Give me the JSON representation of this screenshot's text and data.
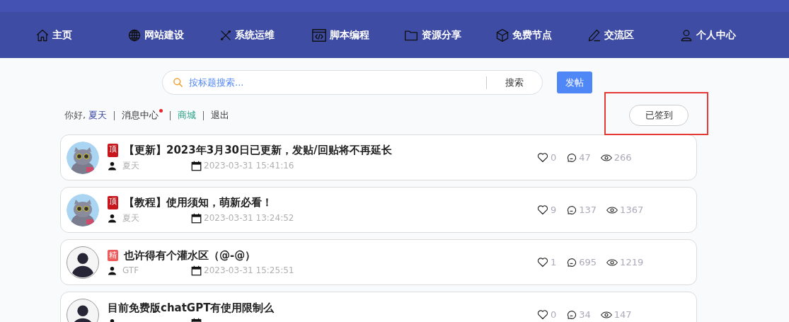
{
  "nav": [
    {
      "label": "主页"
    },
    {
      "label": "网站建设"
    },
    {
      "label": "系统运维"
    },
    {
      "label": "脚本编程"
    },
    {
      "label": "资源分享"
    },
    {
      "label": "免费节点"
    },
    {
      "label": "交流区"
    },
    {
      "label": "个人中心"
    }
  ],
  "search": {
    "placeholder": "按标题搜索...",
    "button": "搜索"
  },
  "post_button": "发帖",
  "user_bar": {
    "greeting": "你好,",
    "username": "夏天",
    "links": [
      {
        "label": "消息中心",
        "unread": true
      },
      {
        "label": "商城",
        "unread": false
      },
      {
        "label": "退出",
        "unread": false
      }
    ]
  },
  "checkin": {
    "label": "已签到",
    "highlighted": true
  },
  "posts": [
    {
      "kind": "picture",
      "badge": {
        "kind": "top",
        "label": "顶"
      },
      "title": "【更新】2023年3月30日已更新，发贴/回贴将不再延长",
      "author": "夏天",
      "date": "2023-03-31 15:41:16",
      "likes": "0",
      "comments": "47",
      "views": "266"
    },
    {
      "kind": "picture",
      "badge": {
        "kind": "top",
        "label": "顶"
      },
      "title": "【教程】使用须知，萌新必看！",
      "author": "夏天",
      "date": "2023-03-31 13:24:52",
      "likes": "9",
      "comments": "137",
      "views": "1367"
    },
    {
      "kind": "silhouette",
      "badge": {
        "kind": "featured",
        "label": "精"
      },
      "title": "也许得有个灌水区（@-@）",
      "author": "GTF",
      "date": "2023-03-31 15:25:51",
      "likes": "1",
      "comments": "695",
      "views": "1219"
    },
    {
      "kind": "silhouette",
      "title": "目前免费版chatGPT有使用限制么",
      "likes": "0",
      "comments": "34",
      "views": "147"
    }
  ]
}
